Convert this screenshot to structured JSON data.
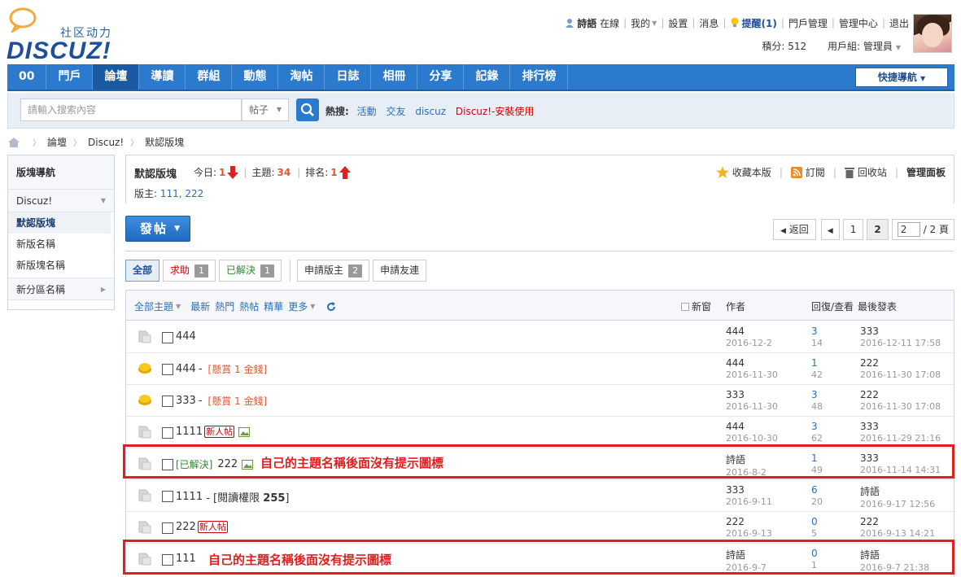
{
  "brand": {
    "slogan": "社区动力",
    "name": "DISCUZ!"
  },
  "topbar": {
    "username": "詩語",
    "online": "在線",
    "my": "我的",
    "settings": "設置",
    "messages": "消息",
    "remind": "提醒(1)",
    "portal_admin": "門戶管理",
    "admin_center": "管理中心",
    "logout": "退出",
    "points": "積分: 512",
    "group": "用戶組: 管理員"
  },
  "nav": {
    "items": [
      "00",
      "門戶",
      "論壇",
      "導讀",
      "群組",
      "動態",
      "淘帖",
      "日誌",
      "相冊",
      "分享",
      "記錄",
      "排行榜"
    ],
    "active_index": 2,
    "quick": "快捷導航"
  },
  "search": {
    "placeholder": "請輸入搜索內容",
    "type": "帖子",
    "hot_label": "熱搜:",
    "keywords": [
      "活動",
      "交友",
      "discuz",
      "Discuz!-安裝使用"
    ]
  },
  "breadcrumb": [
    "論壇",
    "Discuz!",
    "默認版塊"
  ],
  "sidebar": {
    "title": "版塊導航",
    "group": "Discuz!",
    "subs": [
      "默認版塊",
      "新版名稱",
      "新版塊名稱"
    ],
    "group2": "新分區名稱"
  },
  "forum": {
    "name": "默認版塊",
    "today_label": "今日:",
    "today": "1",
    "threads_label": "主題:",
    "threads": "34",
    "rank_label": "排名:",
    "rank": "1",
    "mods_label": "版主:",
    "mods": "111, 222",
    "actions": {
      "favorite": "收藏本版",
      "rss": "訂閱",
      "recycle": "回收站",
      "manage": "管理面板"
    }
  },
  "post_button": "發帖",
  "pager": {
    "back": "返回",
    "p1": "1",
    "p2": "2",
    "input": "2",
    "total": "/ 2 頁"
  },
  "filters": {
    "all": "全部",
    "help": "求助",
    "help_count": "1",
    "solved": "已解決",
    "solved_count": "1",
    "apply_mod": "申請版主",
    "apply_mod_count": "2",
    "apply_link": "申請友連"
  },
  "thread_head": {
    "all_threads": "全部主題",
    "latest": "最新",
    "hot": "熱門",
    "hot_posts": "熱帖",
    "digest": "精華",
    "more": "更多",
    "new_window": "新窗",
    "author": "作者",
    "replies": "回復/查看",
    "last_post": "最後發表"
  },
  "threads": [
    {
      "title": "444",
      "author": "444",
      "date": "2016-12-2",
      "replies": "3",
      "views": "14",
      "last_user": "333",
      "last_time": "2016-12-11 17:58",
      "icon": "normal"
    },
    {
      "title": "444",
      "reward": "[懸賞 1 金錢]",
      "author": "444",
      "date": "2016-11-30",
      "replies": "1",
      "views": "42",
      "last_user": "222",
      "last_time": "2016-11-30 17:08",
      "icon": "reward"
    },
    {
      "title": "333",
      "reward": "[懸賞 1 金錢]",
      "author": "333",
      "date": "2016-11-30",
      "replies": "3",
      "views": "48",
      "last_user": "222",
      "last_time": "2016-11-30 17:08",
      "icon": "reward"
    },
    {
      "title": "1111",
      "badge": "新人帖",
      "author": "444",
      "date": "2016-10-30",
      "replies": "3",
      "views": "62",
      "last_user": "333",
      "last_time": "2016-11-29 21:16",
      "icon": "normal"
    },
    {
      "solved": "[已解決]",
      "title": "222",
      "author": "詩語",
      "date": "2016-8-2",
      "replies": "1",
      "views": "49",
      "last_user": "333",
      "last_time": "2016-11-14 14:31",
      "icon": "normal"
    },
    {
      "title": "1111",
      "perm": "- [閱讀權限",
      "perm_value": "255",
      "perm_end": "]",
      "author": "333",
      "date": "2016-9-11",
      "replies": "6",
      "views": "20",
      "last_user": "詩語",
      "last_time": "2016-9-17 12:56",
      "icon": "normal"
    },
    {
      "title": "222",
      "badge": "新人帖",
      "author": "222",
      "date": "2016-9-13",
      "replies": "0",
      "views": "5",
      "last_user": "222",
      "last_time": "2016-9-13 14:21",
      "icon": "normal"
    },
    {
      "title": "111",
      "author": "詩語",
      "date": "2016-9-7",
      "replies": "0",
      "views": "1",
      "last_user": "詩語",
      "last_time": "2016-9-7 21:38",
      "icon": "normal"
    }
  ],
  "annotations": {
    "note1": "自己的主題名稱後面沒有提示圖標",
    "note2": "自己的主題名稱後面沒有提示圖標"
  },
  "colors": {
    "nav_blue": "#2b7acd",
    "annotation_red": "#e02020",
    "accent_orange": "#e4572e"
  }
}
